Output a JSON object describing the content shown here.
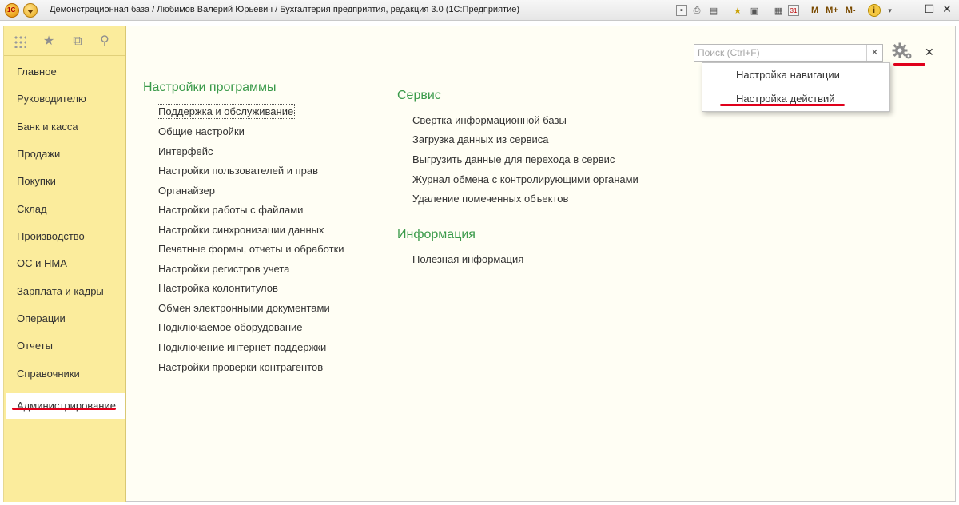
{
  "window": {
    "title": "Демонстрационная база / Любимов Валерий Юрьевич / Бухгалтерия предприятия, редакция 3.0  (1С:Предприятие)",
    "toolbar_m_labels": [
      "M",
      "M+",
      "M-"
    ],
    "calendar_day": "31"
  },
  "sidebar": {
    "items": [
      {
        "label": "Главное"
      },
      {
        "label": "Руководителю"
      },
      {
        "label": "Банк и касса"
      },
      {
        "label": "Продажи"
      },
      {
        "label": "Покупки"
      },
      {
        "label": "Склад"
      },
      {
        "label": "Производство"
      },
      {
        "label": "ОС и НМА"
      },
      {
        "label": "Зарплата и кадры"
      },
      {
        "label": "Операции"
      },
      {
        "label": "Отчеты"
      },
      {
        "label": "Справочники"
      },
      {
        "label": "Администрирование"
      }
    ],
    "active": "Администрирование"
  },
  "search": {
    "placeholder": "Поиск (Ctrl+F)",
    "value": ""
  },
  "settings_menu": {
    "items": [
      "Настройка навигации",
      "Настройка действий"
    ]
  },
  "sections": {
    "program_settings": {
      "title": "Настройки программы",
      "links": [
        "Поддержка и обслуживание",
        "Общие настройки",
        "Интерфейс",
        "Настройки пользователей и прав",
        "Органайзер",
        "Настройки работы с файлами",
        "Настройки синхронизации данных",
        "Печатные формы, отчеты и обработки",
        "Настройки регистров учета",
        "Настройка колонтитулов",
        "Обмен электронными документами",
        "Подключаемое оборудование",
        "Подключение интернет-поддержки",
        "Настройки проверки контрагентов"
      ]
    },
    "service": {
      "title": "Сервис",
      "links": [
        "Свертка информационной базы",
        "Загрузка данных из сервиса",
        "Выгрузить данные для перехода в сервис",
        "Журнал обмена с контролирующими органами",
        "Удаление помеченных объектов"
      ]
    },
    "information": {
      "title": "Информация",
      "links": [
        "Полезная информация"
      ]
    }
  },
  "colors": {
    "section_title": "#3a9a4a",
    "sidebar_bg": "#fbec9c",
    "annotation_red": "#e0001b"
  }
}
